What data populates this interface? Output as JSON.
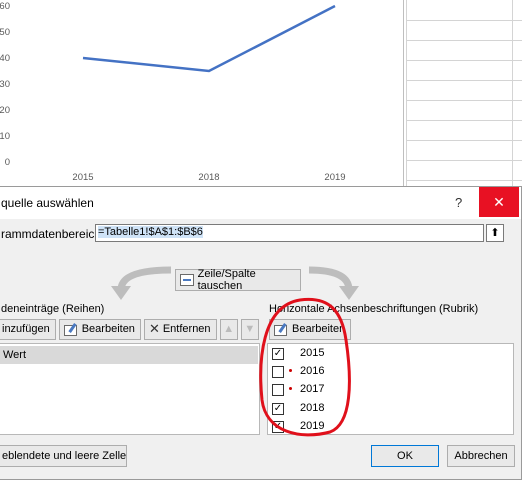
{
  "chart_data": {
    "type": "line",
    "categories": [
      "2015",
      "2018",
      "2019"
    ],
    "values": [
      40,
      35,
      60
    ],
    "y_ticks": [
      "60",
      "50",
      "40",
      "30",
      "20",
      "10",
      "0"
    ],
    "ylim": [
      0,
      60
    ],
    "grid": false,
    "line_color": "#4472c4"
  },
  "dialog": {
    "title": "quelle auswählen",
    "help": "?",
    "close": "✕",
    "range_label": "rammdatenbereich:",
    "range_value": "=Tabelle1!$A$1:$B$6",
    "switch_label": "Zeile/Spalte tauschen",
    "left_group_label": "deneinträge (Reihen)",
    "left_buttons": {
      "add": "inzufügen",
      "edit": "Bearbeiten",
      "remove": "Entfernen",
      "up": "▲",
      "down": "▼"
    },
    "series": [
      "Wert"
    ],
    "right_group_label": "Horizontale Achsenbeschriftungen (Rubrik)",
    "right_edit": "Bearbeiten",
    "categories": [
      {
        "label": "2015",
        "checked": true,
        "dot": false
      },
      {
        "label": "2016",
        "checked": false,
        "dot": true
      },
      {
        "label": "2017",
        "checked": false,
        "dot": true
      },
      {
        "label": "2018",
        "checked": true,
        "dot": false
      },
      {
        "label": "2019",
        "checked": true,
        "dot": false
      }
    ],
    "hidden_cells": "eblendete und leere Zellen",
    "ok": "OK",
    "cancel": "Abbrechen"
  },
  "colors": {
    "close_button": "#e81123",
    "annotation": "#e0101b",
    "line": "#4472c4"
  }
}
